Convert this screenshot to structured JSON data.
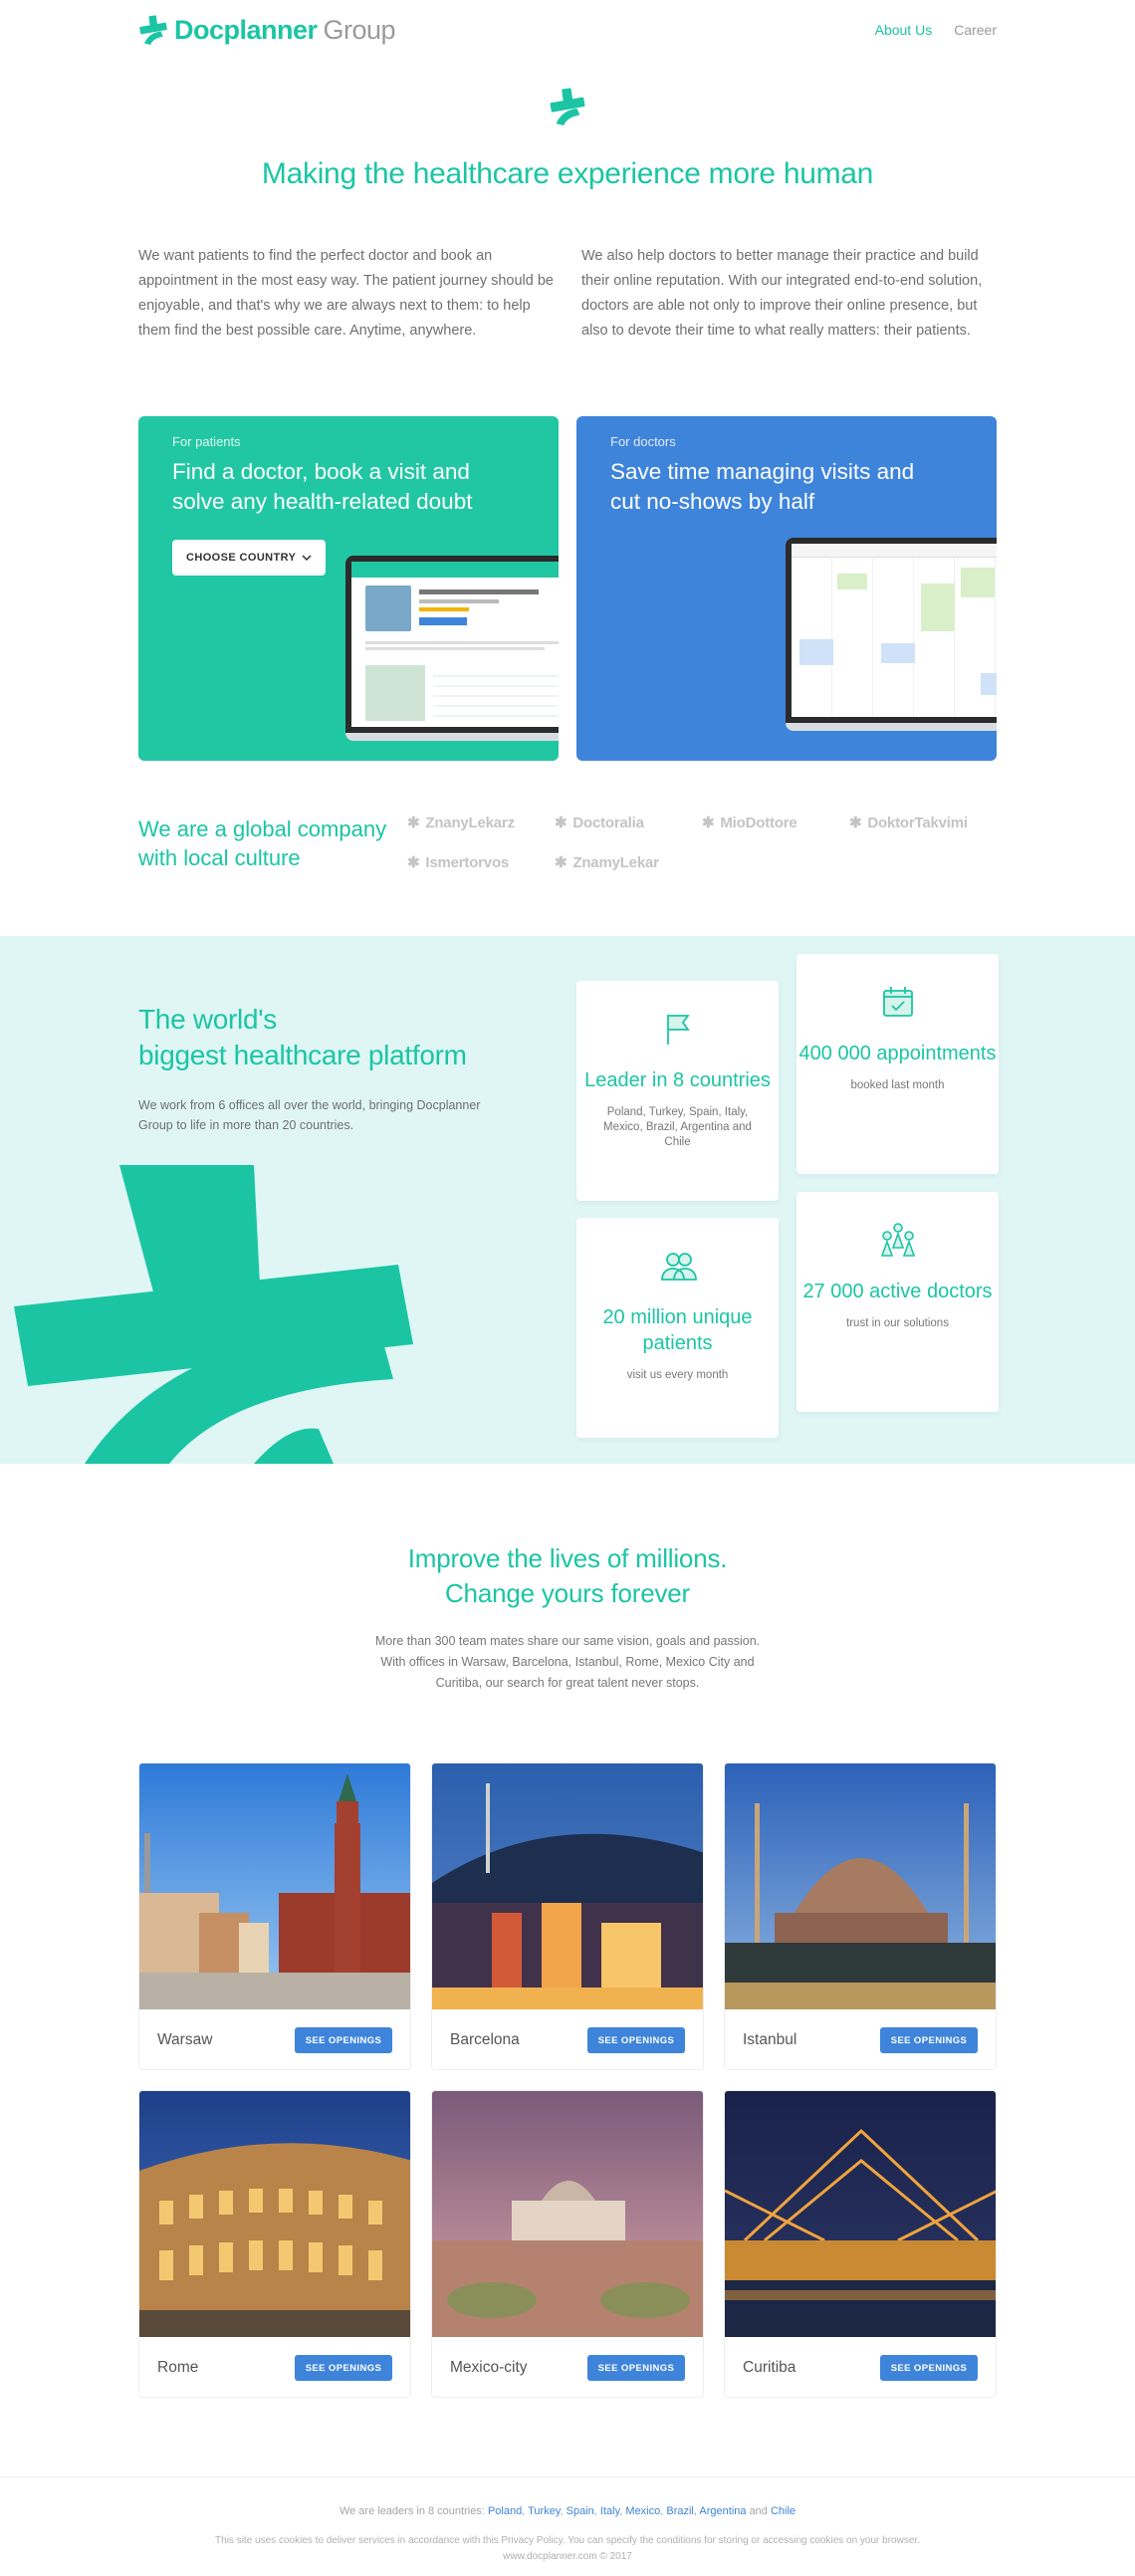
{
  "header": {
    "brand": "Docplanner",
    "brand_suffix": "Group",
    "nav": [
      {
        "label": "About Us",
        "active": true
      },
      {
        "label": "Career",
        "active": false
      }
    ]
  },
  "hero": {
    "title": "Making the healthcare experience more human",
    "left_text": "We want patients to find the perfect doctor and book an appointment in the most easy way. The patient journey should be enjoyable, and that's why we are always next to them: to help them find the best possible care. Anytime, anywhere.",
    "right_text": "We also help doctors to better manage their practice and build their online reputation. With our integrated end-to-end solution, doctors are able not only to improve their online presence, but also to devote their time to what really matters: their patients."
  },
  "cards": {
    "patients": {
      "eyebrow": "For patients",
      "title": "Find a doctor, book a visit and solve any health-related doubt",
      "button": "CHOOSE COUNTRY",
      "color": "#21c7a3"
    },
    "doctors": {
      "eyebrow": "For doctors",
      "title": "Save time managing visits and cut no-shows by half",
      "color": "#3f84db"
    }
  },
  "global": {
    "title": "We are a global company with local culture",
    "brands": [
      "ZnanyLekarz",
      "Doctoralia",
      "MioDottore",
      "DoktorTakvimi",
      "Ismertorvos",
      "ZnamyLekar"
    ]
  },
  "platform": {
    "title_line1": "The world's",
    "title_line2": "biggest healthcare platform",
    "text": "We work from 6 offices all over the world, bringing Docplanner Group to life in more than 20 countries.",
    "stats": [
      {
        "icon": "flag-icon",
        "title": "Leader in 8 countries",
        "sub": "Poland, Turkey, Spain, Italy, Mexico, Brazil, Argentina and Chile"
      },
      {
        "icon": "calendar-check-icon",
        "title": "400 000 appointments",
        "sub": "booked last month"
      },
      {
        "icon": "users-icon",
        "title": "20 million unique patients",
        "sub": "visit us every month"
      },
      {
        "icon": "doctors-icon",
        "title": "27 000 active doctors",
        "sub": "trust in our solutions"
      }
    ]
  },
  "improve": {
    "title_line1": "Improve the lives of millions.",
    "title_line2": "Change yours forever",
    "text_line1": "More than 300 team mates share our same vision, goals and passion.",
    "text_line2": "With offices in Warsaw, Barcelona, Istanbul, Rome, Mexico City and",
    "text_line3": "Curitiba, our search for great talent never stops."
  },
  "offices": [
    {
      "city": "Warsaw",
      "button": "SEE OPENINGS"
    },
    {
      "city": "Barcelona",
      "button": "SEE OPENINGS"
    },
    {
      "city": "Istanbul",
      "button": "SEE OPENINGS"
    },
    {
      "city": "Rome",
      "button": "SEE OPENINGS"
    },
    {
      "city": "Mexico-city",
      "button": "SEE OPENINGS"
    },
    {
      "city": "Curitiba",
      "button": "SEE OPENINGS"
    }
  ],
  "footer": {
    "leaders_prefix": "We are leaders in 8 countries:",
    "countries": [
      "Poland",
      "Turkey",
      "Spain",
      "Italy",
      "Mexico",
      "Brazil",
      "Argentina"
    ],
    "and": "and",
    "last_country": "Chile",
    "cookies": "This site uses cookies to deliver services in accordance with this Privacy Policy. You can specify the conditions for storing or accessing cookies on your browser.",
    "copyright": "www.docplanner.com © 2017"
  },
  "colors": {
    "accent": "#1bc5a4",
    "blue": "#3f84db",
    "band": "#dff6f5"
  }
}
